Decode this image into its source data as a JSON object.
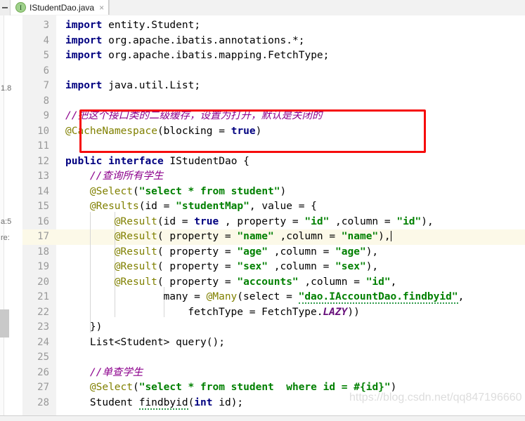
{
  "window": {
    "collapse_icon": "minus-icon"
  },
  "tab": {
    "icon": "interface-icon",
    "icon_letter": "I",
    "label": "IStudentDao.java",
    "close": "×"
  },
  "editor": {
    "background_fragments": [
      "1.8",
      "a:5",
      "re:"
    ],
    "current_line": 17,
    "caret_line": 17,
    "gutter": {
      "first_line": 3,
      "last_line": 28,
      "line_numbers": [
        3,
        4,
        5,
        6,
        7,
        8,
        9,
        10,
        11,
        12,
        13,
        14,
        15,
        16,
        17,
        18,
        19,
        20,
        21,
        22,
        23,
        24,
        25,
        26,
        27,
        28
      ]
    },
    "intention_bulb": "lightbulb-icon",
    "lines": [
      {
        "n": 3,
        "tokens": [
          {
            "t": "kw",
            "s": "import"
          },
          {
            "t": "pln",
            "s": " entity.Student;"
          }
        ]
      },
      {
        "n": 4,
        "tokens": [
          {
            "t": "kw",
            "s": "import"
          },
          {
            "t": "pln",
            "s": " org.apache.ibatis.annotations.*;"
          }
        ]
      },
      {
        "n": 5,
        "tokens": [
          {
            "t": "kw",
            "s": "import"
          },
          {
            "t": "pln",
            "s": " org.apache.ibatis.mapping.FetchType;"
          }
        ]
      },
      {
        "n": 6,
        "tokens": []
      },
      {
        "n": 7,
        "tokens": [
          {
            "t": "kw",
            "s": "import"
          },
          {
            "t": "pln",
            "s": " java.util.List;"
          }
        ]
      },
      {
        "n": 8,
        "tokens": []
      },
      {
        "n": 9,
        "tokens": [
          {
            "t": "cmt",
            "s": "//把这个接口类的二级缓存，设置为打开，默认是关闭的"
          }
        ]
      },
      {
        "n": 10,
        "tokens": [
          {
            "t": "ann",
            "s": "@CacheNamespace"
          },
          {
            "t": "pln",
            "s": "(blocking = "
          },
          {
            "t": "kw",
            "s": "true"
          },
          {
            "t": "pln",
            "s": ")"
          }
        ]
      },
      {
        "n": 11,
        "tokens": []
      },
      {
        "n": 12,
        "tokens": [
          {
            "t": "kw",
            "s": "public interface"
          },
          {
            "t": "pln",
            "s": " IStudentDao {"
          }
        ]
      },
      {
        "n": 13,
        "tokens": [
          {
            "t": "cmt",
            "s": "//查询所有学生"
          }
        ]
      },
      {
        "n": 14,
        "tokens": [
          {
            "t": "ann",
            "s": "@Select"
          },
          {
            "t": "pln",
            "s": "("
          },
          {
            "t": "str",
            "s": "\"select * from student\""
          },
          {
            "t": "pln",
            "s": ")"
          }
        ]
      },
      {
        "n": 15,
        "tokens": [
          {
            "t": "ann",
            "s": "@Results"
          },
          {
            "t": "pln",
            "s": "(id = "
          },
          {
            "t": "str",
            "s": "\"studentMap\""
          },
          {
            "t": "pln",
            "s": ", value = {"
          }
        ]
      },
      {
        "n": 16,
        "tokens": [
          {
            "t": "ann",
            "s": "@Result"
          },
          {
            "t": "pln",
            "s": "(id = "
          },
          {
            "t": "kw",
            "s": "true"
          },
          {
            "t": "pln",
            "s": " , property = "
          },
          {
            "t": "str",
            "s": "\"id\""
          },
          {
            "t": "pln",
            "s": " ,column = "
          },
          {
            "t": "str",
            "s": "\"id\""
          },
          {
            "t": "pln",
            "s": "),"
          }
        ]
      },
      {
        "n": 17,
        "tokens": [
          {
            "t": "ann",
            "s": "@Result"
          },
          {
            "t": "pln",
            "s": "( property = "
          },
          {
            "t": "str",
            "s": "\"name\""
          },
          {
            "t": "pln",
            "s": " ,column = "
          },
          {
            "t": "str",
            "s": "\"name\""
          },
          {
            "t": "pln",
            "s": "),"
          }
        ]
      },
      {
        "n": 18,
        "tokens": [
          {
            "t": "ann",
            "s": "@Result"
          },
          {
            "t": "pln",
            "s": "( property = "
          },
          {
            "t": "str",
            "s": "\"age\""
          },
          {
            "t": "pln",
            "s": " ,column = "
          },
          {
            "t": "str",
            "s": "\"age\""
          },
          {
            "t": "pln",
            "s": "),"
          }
        ]
      },
      {
        "n": 19,
        "tokens": [
          {
            "t": "ann",
            "s": "@Result"
          },
          {
            "t": "pln",
            "s": "( property = "
          },
          {
            "t": "str",
            "s": "\"sex\""
          },
          {
            "t": "pln",
            "s": " ,column = "
          },
          {
            "t": "str",
            "s": "\"sex\""
          },
          {
            "t": "pln",
            "s": "),"
          }
        ]
      },
      {
        "n": 20,
        "tokens": [
          {
            "t": "ann",
            "s": "@Result"
          },
          {
            "t": "pln",
            "s": "( property = "
          },
          {
            "t": "str",
            "s": "\"accounts\""
          },
          {
            "t": "pln",
            "s": " ,column = "
          },
          {
            "t": "str",
            "s": "\"id\""
          },
          {
            "t": "pln",
            "s": ","
          }
        ]
      },
      {
        "n": 21,
        "tokens": [
          {
            "t": "pln",
            "s": "many = "
          },
          {
            "t": "ann",
            "s": "@Many"
          },
          {
            "t": "pln",
            "s": "(select = "
          },
          {
            "t": "str squig",
            "s": "\"dao.IAccountDao.findbyid\""
          },
          {
            "t": "pln",
            "s": ","
          }
        ]
      },
      {
        "n": 22,
        "tokens": [
          {
            "t": "pln",
            "s": "fetchType = FetchType."
          },
          {
            "t": "stat",
            "s": "LAZY"
          },
          {
            "t": "pln",
            "s": "))"
          }
        ]
      },
      {
        "n": 23,
        "tokens": [
          {
            "t": "pln",
            "s": "})"
          }
        ]
      },
      {
        "n": 24,
        "tokens": [
          {
            "t": "pln",
            "s": "List<Student> query();"
          }
        ]
      },
      {
        "n": 25,
        "tokens": []
      },
      {
        "n": 26,
        "tokens": [
          {
            "t": "cmt",
            "s": "//单查学生"
          }
        ]
      },
      {
        "n": 27,
        "tokens": [
          {
            "t": "ann",
            "s": "@Select"
          },
          {
            "t": "pln",
            "s": "("
          },
          {
            "t": "str",
            "s": "\"select * from student  where id = #{id}\""
          },
          {
            "t": "pln",
            "s": ")"
          }
        ]
      },
      {
        "n": 28,
        "tokens": [
          {
            "t": "pln",
            "s": "Student "
          },
          {
            "t": "pln squig",
            "s": "findbyid"
          },
          {
            "t": "pln",
            "s": "("
          },
          {
            "t": "kw",
            "s": "int"
          },
          {
            "t": "pln",
            "s": " id);"
          }
        ]
      }
    ],
    "annotation_box": {
      "color": "#f60c0c",
      "covers_lines": [
        9,
        10
      ]
    },
    "watermark": "https://blog.csdn.net/qq847196660"
  },
  "colors": {
    "keyword": "#000080",
    "annotation": "#808000",
    "string": "#008000",
    "comment": "#8c008c",
    "static_field": "#660e7a",
    "current_line_bg": "#fcf9e8",
    "gutter_bg": "#f2f2f2",
    "highlight_box": "#f60c0c"
  }
}
